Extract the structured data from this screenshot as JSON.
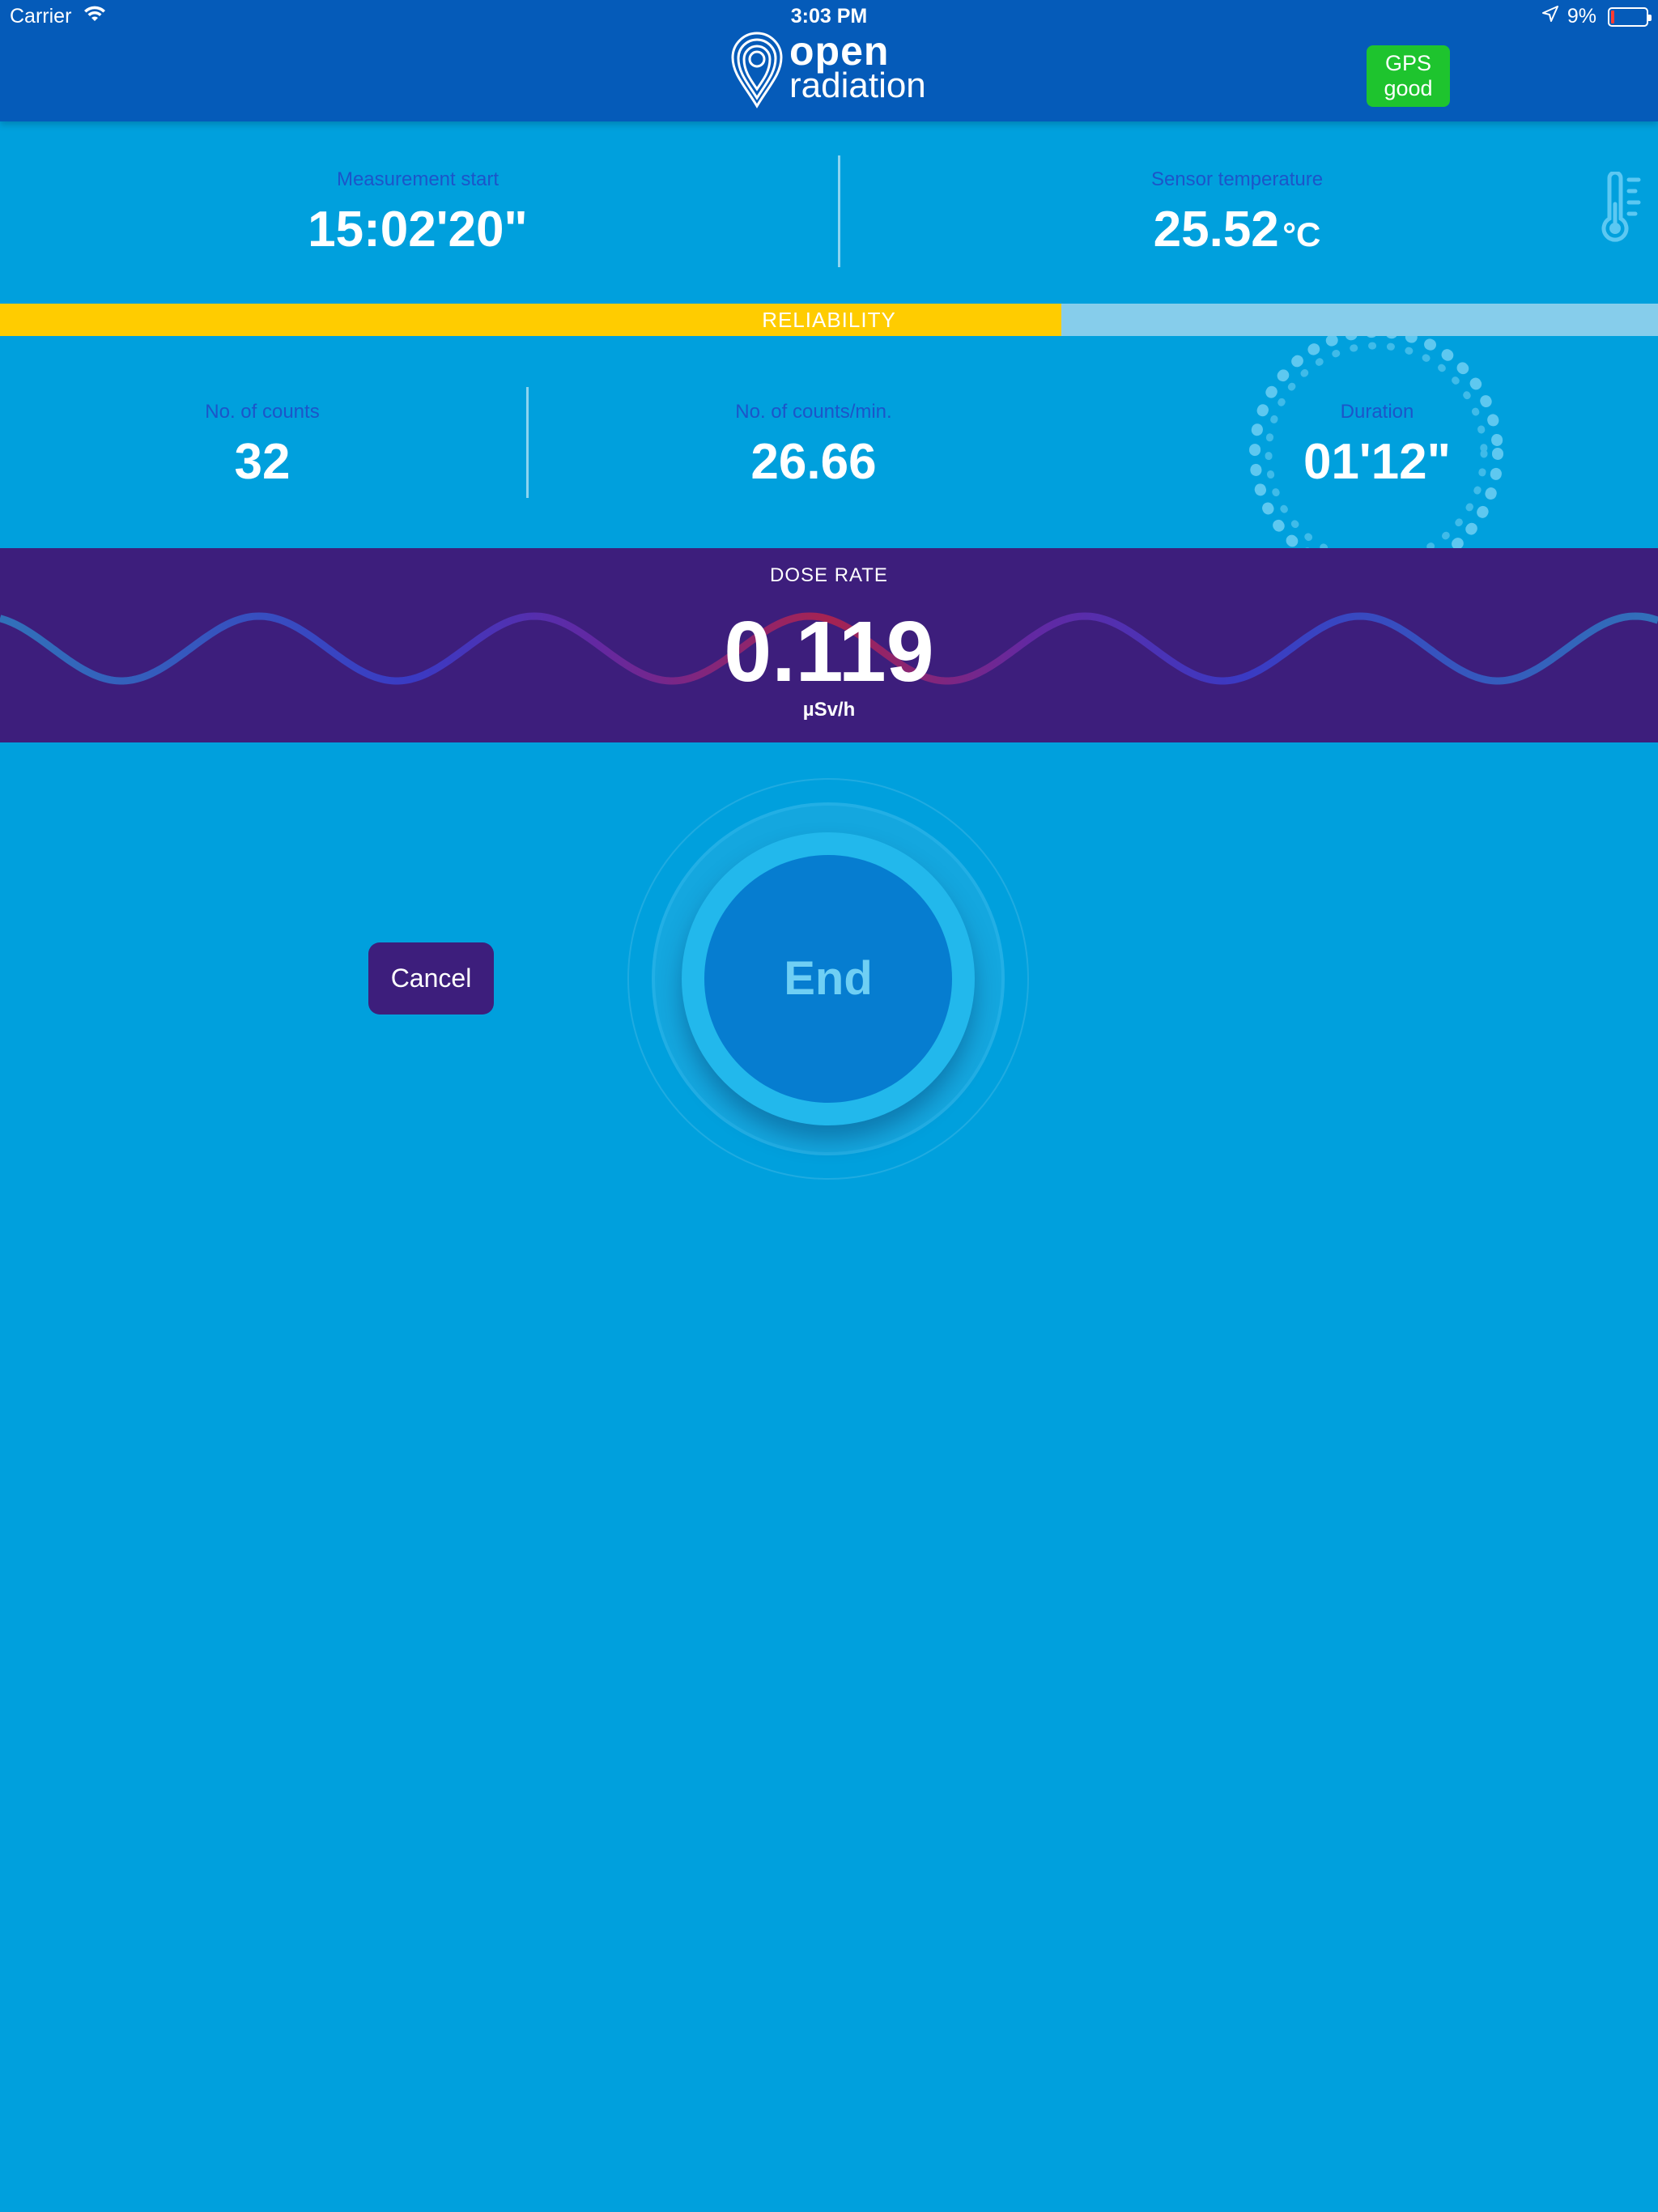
{
  "status_bar": {
    "carrier": "Carrier",
    "time": "3:03 PM",
    "battery": "9%",
    "battery_level": 0.09
  },
  "header": {
    "logo_line1": "open",
    "logo_line2": "radiation",
    "gps_line1": "GPS",
    "gps_line2": "good",
    "gps_color": "#1ec42e",
    "bar_color": "#055bb9"
  },
  "measurement": {
    "start_label": "Measurement start",
    "start_value": "15:02'20\"",
    "temp_label": "Sensor temperature",
    "temp_value": "25.52",
    "temp_unit": "°C"
  },
  "reliability": {
    "label": "RELIABILITY",
    "fraction": 0.64,
    "fill_color": "#ffcc00"
  },
  "counts": {
    "counts_label": "No. of counts",
    "counts_value": "32",
    "cpm_label": "No. of counts/min.",
    "cpm_value": "26.66",
    "duration_label": "Duration",
    "duration_value": "01'12\""
  },
  "dose": {
    "label": "DOSE RATE",
    "value": "0.119",
    "unit": "µSv/h",
    "bg_color": "#3d1e7c"
  },
  "controls": {
    "cancel_label": "Cancel",
    "end_label": "End"
  },
  "colors": {
    "background": "#00a0dd",
    "label_blue": "#1c55c9"
  }
}
